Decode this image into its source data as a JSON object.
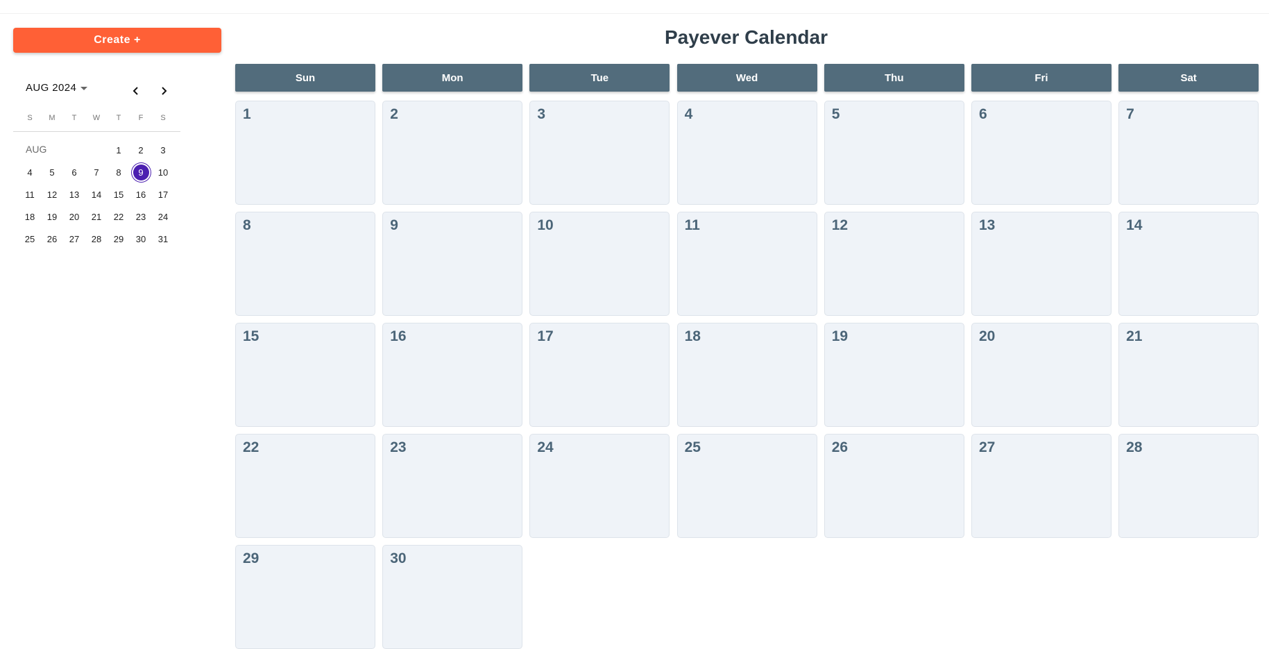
{
  "sidebar": {
    "create_label": "Create +",
    "mini_calendar": {
      "month_label": "AUG 2024",
      "month_tag": "AUG",
      "weekday_initials": [
        "S",
        "M",
        "T",
        "W",
        "T",
        "F",
        "S"
      ],
      "leading_blanks": 4,
      "days": [
        "1",
        "2",
        "3",
        "4",
        "5",
        "6",
        "7",
        "8",
        "9",
        "10",
        "11",
        "12",
        "13",
        "14",
        "15",
        "16",
        "17",
        "18",
        "19",
        "20",
        "21",
        "22",
        "23",
        "24",
        "25",
        "26",
        "27",
        "28",
        "29",
        "30",
        "31"
      ],
      "selected_day": "9",
      "selected_color": "#4b1fb0"
    }
  },
  "main": {
    "title": "Payever Calendar",
    "weekdays": [
      "Sun",
      "Mon",
      "Tue",
      "Wed",
      "Thu",
      "Fri",
      "Sat"
    ],
    "days": [
      "1",
      "2",
      "3",
      "4",
      "5",
      "6",
      "7",
      "8",
      "9",
      "10",
      "11",
      "12",
      "13",
      "14",
      "15",
      "16",
      "17",
      "18",
      "19",
      "20",
      "21",
      "22",
      "23",
      "24",
      "25",
      "26",
      "27",
      "28",
      "29",
      "30"
    ],
    "header_color": "#526c7c",
    "accent_color": "#ff6036"
  }
}
